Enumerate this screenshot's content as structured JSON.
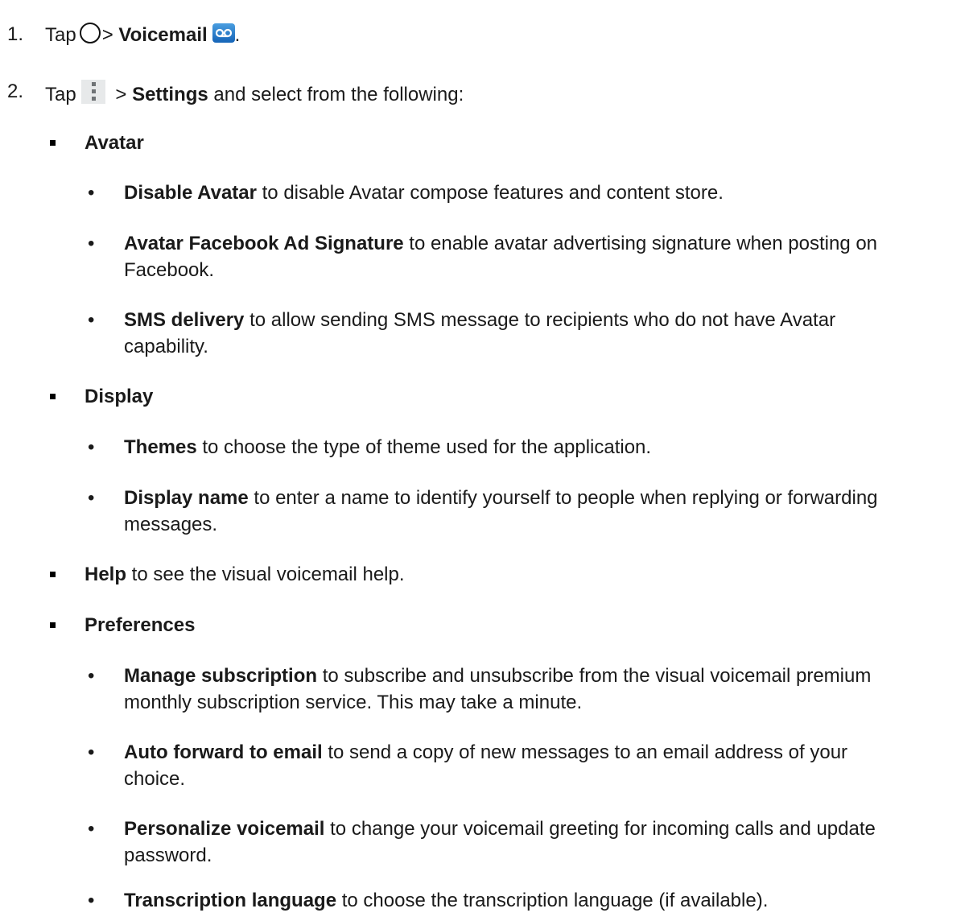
{
  "step1": {
    "num": "1.",
    "tap": "Tap",
    "sep": ">",
    "voicemail": "Voicemail",
    "end": "."
  },
  "step2": {
    "num": "2.",
    "tap": "Tap",
    "sep": ">",
    "settings": "Settings",
    "rest": "and select from the following:"
  },
  "icons": {
    "home": "home-circle-icon",
    "voicemail": "voicemail-icon",
    "menu": "more-options-icon"
  },
  "avatar": {
    "heading": "Avatar",
    "items": [
      {
        "bold": "Disable Avatar",
        "text": " to disable Avatar compose features and content store."
      },
      {
        "bold": "Avatar Facebook Ad Signature",
        "text": " to enable avatar advertising signature when posting on",
        "cont": "Facebook."
      },
      {
        "bold": "SMS delivery",
        "text": " to allow sending SMS message to recipients who do not have Avatar",
        "cont": "capability."
      }
    ]
  },
  "display": {
    "heading": "Display",
    "items": [
      {
        "bold": "Themes",
        "text": " to choose the type of theme used for the application."
      },
      {
        "bold": "Display name",
        "text": " to enter a name to identify yourself to people when replying or forwarding",
        "cont": "messages."
      }
    ]
  },
  "help": {
    "bold": "Help",
    "text": " to see the visual voicemail help."
  },
  "preferences": {
    "heading": "Preferences",
    "items": [
      {
        "bold": "Manage subscription",
        "text": " to subscribe and unsubscribe from the visual voicemail premium",
        "cont": "monthly subscription service. This may take a minute."
      },
      {
        "bold": "Auto forward to email",
        "text": " to send a copy of new messages to an email address of your",
        "cont": "choice."
      },
      {
        "bold": "Personalize voicemail",
        "text": " to change your voicemail greeting for incoming calls and update",
        "cont": "password."
      },
      {
        "bold": "Transcription language",
        "text": " to choose the transcription language (if available)."
      }
    ]
  },
  "bullet_dot": "•"
}
